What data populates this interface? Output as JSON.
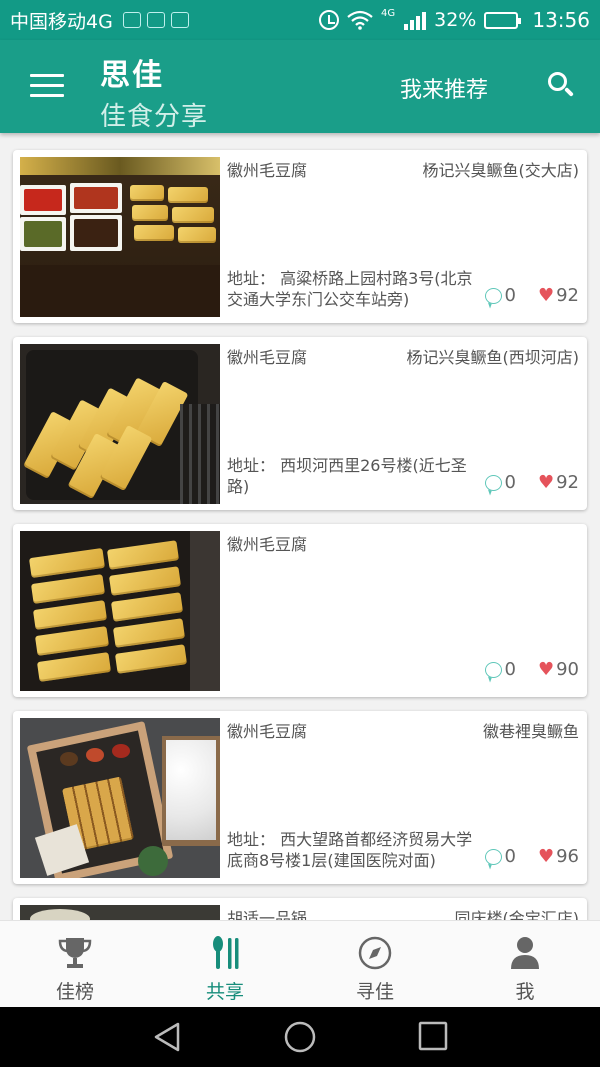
{
  "status_bar": {
    "carrier": "中国移动4G",
    "network_tag": "4G",
    "battery": "32%",
    "time": "13:56"
  },
  "app_bar": {
    "title": "思佳",
    "subtitle": "佳食分享",
    "recommend_label": "我来推荐",
    "menu_icon": "menu-icon",
    "search_icon": "search-icon"
  },
  "cards": [
    {
      "dish": "徽州毛豆腐",
      "shop": "杨记兴臭鳜鱼(交大店)",
      "address": "地址：  高粱桥路上园村路3号(北京交通大学东门公交车站旁)",
      "comments": "0",
      "likes": "92"
    },
    {
      "dish": "徽州毛豆腐",
      "shop": "杨记兴臭鳜鱼(西坝河店)",
      "address": "地址：  西坝河西里26号楼(近七圣路)",
      "comments": "0",
      "likes": "92"
    },
    {
      "dish": "徽州毛豆腐",
      "shop": "",
      "address": "",
      "comments": "0",
      "likes": "90"
    },
    {
      "dish": "徽州毛豆腐",
      "shop": "徽巷裡臭鳜鱼",
      "address": "地址：  西大望路首都经济贸易大学底商8号楼1层(建国医院对面)",
      "comments": "0",
      "likes": "96"
    },
    {
      "dish": "胡适一品锅",
      "shop": "同庆楼(金宝汇店)",
      "address": "",
      "comments": "",
      "likes": ""
    }
  ],
  "bottom_nav": [
    {
      "label": "佳榜",
      "icon": "trophy-icon",
      "active": false
    },
    {
      "label": "共享",
      "icon": "cutlery-icon",
      "active": true
    },
    {
      "label": "寻佳",
      "icon": "compass-icon",
      "active": false
    },
    {
      "label": "我",
      "icon": "person-icon",
      "active": false
    }
  ],
  "colors": {
    "primary": "#1a9e89",
    "status_bar": "#129a86",
    "active_tab": "#178d7b",
    "heart": "#e5535b",
    "comment": "#5fc7b9"
  }
}
